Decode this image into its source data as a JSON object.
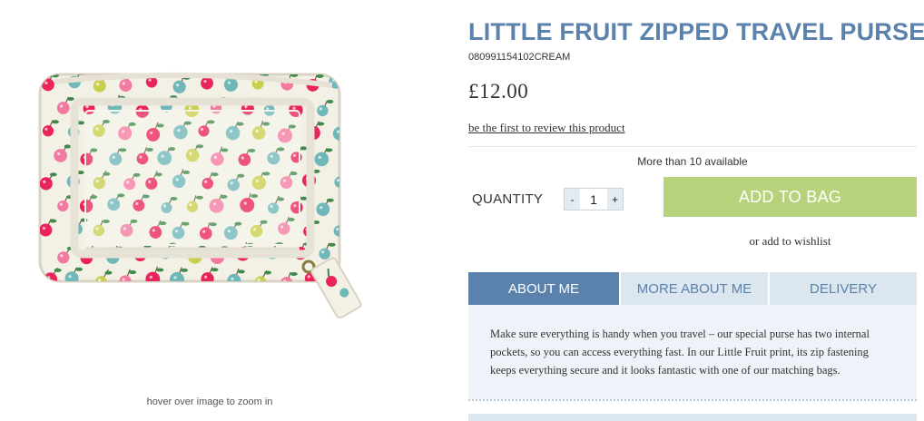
{
  "product": {
    "title": "LITTLE FRUIT ZIPPED TRAVEL PURSE",
    "sku": "080991154102CREAM",
    "price": "£12.00",
    "review_link": "be the first to review this product",
    "availability": "More than 10 available"
  },
  "image": {
    "zoom_hint": "hover over image to zoom in",
    "colors": {
      "fabric": "#f3f1e6",
      "cherry": "#e8245a",
      "pink": "#f27aa0",
      "teal": "#6fb7b9",
      "lime": "#c9cf4e",
      "leaf": "#3f8a4a",
      "piping": "#d9d3c4",
      "zip": "#8a7a45"
    }
  },
  "purchase": {
    "quantity_label": "QUANTITY",
    "decrement_label": "-",
    "increment_label": "+",
    "quantity_value": "1",
    "add_button": "ADD TO BAG",
    "wishlist_link": "or add to wishlist",
    "add_button_color": "#b6d27a"
  },
  "tabs": [
    {
      "label": "ABOUT ME",
      "active": true
    },
    {
      "label": "MORE ABOUT ME",
      "active": false
    },
    {
      "label": "DELIVERY",
      "active": false
    }
  ],
  "tab_panel": {
    "text": "Make sure everything is handy when you travel – our special purse has two internal pockets, so you can access everything fast. In our Little Fruit print, its zip fastening keeps everything secure and it looks fantastic with one of our matching bags."
  },
  "theme": {
    "accent": "#5b82ad",
    "tab_inactive_bg": "#dbe6ef",
    "panel_bg": "#edf3f8"
  }
}
